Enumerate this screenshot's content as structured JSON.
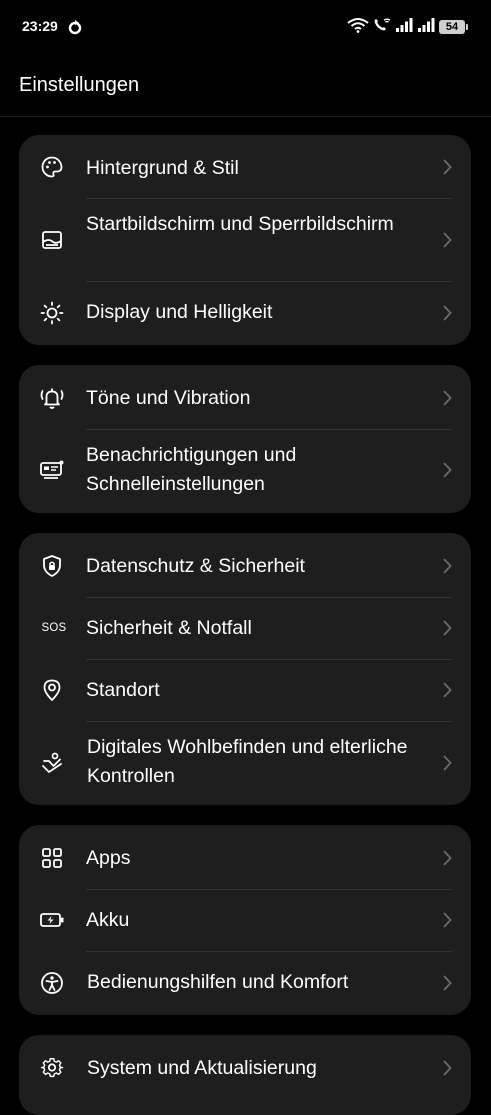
{
  "status_bar": {
    "time": "23:29",
    "battery": "54"
  },
  "header": {
    "title": "Einstellungen"
  },
  "groups": [
    {
      "items": [
        {
          "label": "Hintergrund & Stil",
          "icon": "palette-icon"
        },
        {
          "label": "Startbildschirm und Sperrbildschirm",
          "icon": "home-screen-icon"
        },
        {
          "label": "Display und Helligkeit",
          "icon": "brightness-icon"
        }
      ]
    },
    {
      "items": [
        {
          "label": "Töne und Vibration",
          "icon": "bell-vibrate-icon"
        },
        {
          "label": "Benachrichtigungen und Schnelleinstellungen",
          "icon": "notification-panel-icon"
        }
      ]
    },
    {
      "items": [
        {
          "label": "Datenschutz & Sicherheit",
          "icon": "shield-lock-icon"
        },
        {
          "label": "Sicherheit & Notfall",
          "icon": "sos-icon",
          "icon_text": "SOS"
        },
        {
          "label": "Standort",
          "icon": "location-pin-icon"
        },
        {
          "label": "Digitales Wohlbefinden und elterliche Kontrollen",
          "icon": "wellbeing-icon"
        }
      ]
    },
    {
      "items": [
        {
          "label": "Apps",
          "icon": "apps-grid-icon"
        },
        {
          "label": "Akku",
          "icon": "battery-icon"
        },
        {
          "label": "Bedienungshilfen und Komfort",
          "icon": "accessibility-icon"
        }
      ]
    },
    {
      "items": [
        {
          "label": "System und Aktualisierung",
          "icon": "gear-icon"
        }
      ]
    }
  ],
  "colors": {
    "background": "#000000",
    "card": "#1e1e1e",
    "text": "#ffffff",
    "chevron": "#6a6a6a"
  }
}
